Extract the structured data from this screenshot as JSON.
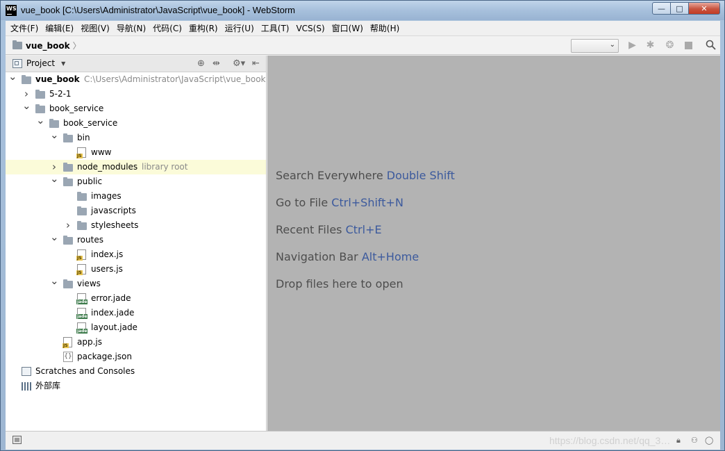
{
  "window": {
    "title": "vue_book [C:\\Users\\Administrator\\JavaScript\\vue_book] - WebStorm",
    "logo_text": "WS",
    "buttons": {
      "minimize": "—",
      "maximize": "□",
      "close": "✕"
    }
  },
  "menu": [
    "文件(F)",
    "编辑(E)",
    "视图(V)",
    "导航(N)",
    "代码(C)",
    "重构(R)",
    "运行(U)",
    "工具(T)",
    "VCS(S)",
    "窗口(W)",
    "帮助(H)"
  ],
  "breadcrumb": {
    "label": "vue_book",
    "icon": "folder-icon"
  },
  "toolbar": {
    "run_config_value": "",
    "icons": [
      "run-icon",
      "debug-icon",
      "coverage-icon",
      "stop-icon",
      "search-icon"
    ]
  },
  "project_panel": {
    "title": "Project",
    "icons": [
      "locate-icon",
      "collapse-all-icon",
      "gear-icon",
      "hide-icon"
    ]
  },
  "tree": [
    {
      "depth": 0,
      "arrow": "down",
      "icon": "folder",
      "label": "vue_book",
      "bold": true,
      "extra": "C:\\Users\\Administrator\\JavaScript\\vue_book"
    },
    {
      "depth": 1,
      "arrow": "right",
      "icon": "folder",
      "label": "5-2-1"
    },
    {
      "depth": 1,
      "arrow": "down",
      "icon": "folder",
      "label": "book_service"
    },
    {
      "depth": 2,
      "arrow": "down",
      "icon": "folder",
      "label": "book_service"
    },
    {
      "depth": 3,
      "arrow": "down",
      "icon": "folder",
      "label": "bin"
    },
    {
      "depth": 4,
      "arrow": "",
      "icon": "js",
      "label": "www"
    },
    {
      "depth": 3,
      "arrow": "right",
      "icon": "folder",
      "label": "node_modules",
      "extra": "library root",
      "highlight": true
    },
    {
      "depth": 3,
      "arrow": "down",
      "icon": "folder",
      "label": "public"
    },
    {
      "depth": 4,
      "arrow": "",
      "icon": "folder",
      "label": "images"
    },
    {
      "depth": 4,
      "arrow": "",
      "icon": "folder",
      "label": "javascripts"
    },
    {
      "depth": 4,
      "arrow": "right",
      "icon": "folder",
      "label": "stylesheets"
    },
    {
      "depth": 3,
      "arrow": "down",
      "icon": "folder",
      "label": "routes"
    },
    {
      "depth": 4,
      "arrow": "",
      "icon": "js",
      "label": "index.js"
    },
    {
      "depth": 4,
      "arrow": "",
      "icon": "js",
      "label": "users.js"
    },
    {
      "depth": 3,
      "arrow": "down",
      "icon": "folder",
      "label": "views"
    },
    {
      "depth": 4,
      "arrow": "",
      "icon": "jade",
      "label": "error.jade"
    },
    {
      "depth": 4,
      "arrow": "",
      "icon": "jade",
      "label": "index.jade"
    },
    {
      "depth": 4,
      "arrow": "",
      "icon": "jade",
      "label": "layout.jade"
    },
    {
      "depth": 3,
      "arrow": "",
      "icon": "js",
      "label": "app.js"
    },
    {
      "depth": 3,
      "arrow": "",
      "icon": "json",
      "label": "package.json"
    },
    {
      "depth": 0,
      "arrow": "",
      "icon": "scratch",
      "label": "Scratches and Consoles"
    },
    {
      "depth": 0,
      "arrow": "",
      "icon": "library",
      "label": "外部库"
    }
  ],
  "editor_hints": [
    {
      "text": "Search Everywhere",
      "shortcut": "Double Shift"
    },
    {
      "text": "Go to File",
      "shortcut": "Ctrl+Shift+N"
    },
    {
      "text": "Recent Files",
      "shortcut": "Ctrl+E"
    },
    {
      "text": "Navigation Bar",
      "shortcut": "Alt+Home"
    },
    {
      "text": "Drop files here to open",
      "shortcut": ""
    }
  ],
  "statusbar": {
    "watermark": "https://blog.csdn.net/qq_3…",
    "icons": [
      "toggle-tool-windows-icon",
      "lock-icon",
      "inspector-icon",
      "event-log-icon"
    ]
  }
}
